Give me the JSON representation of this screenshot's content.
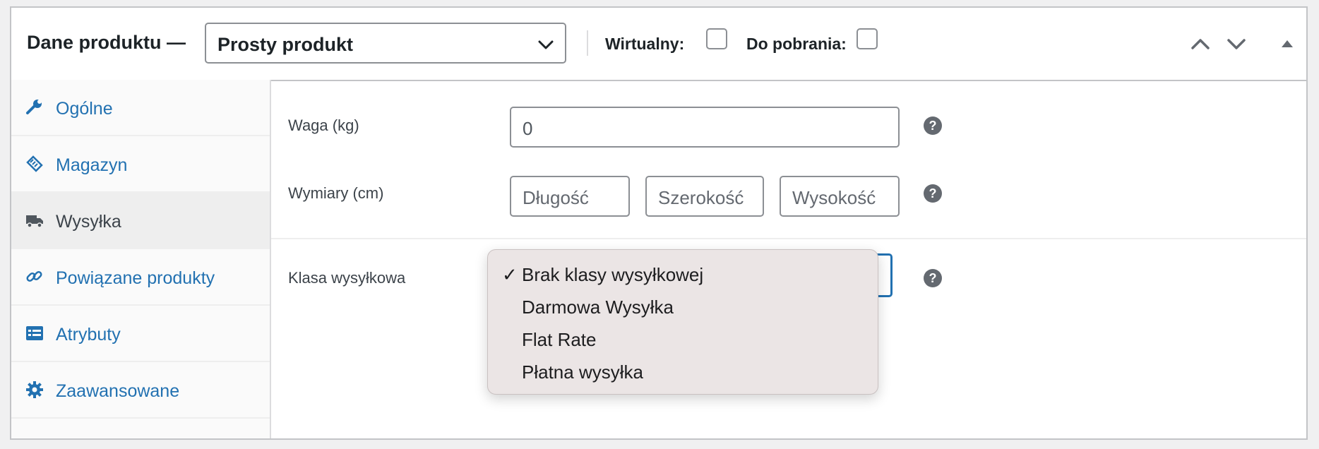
{
  "header": {
    "title": "Dane produktu —",
    "product_type": {
      "selected": "Prosty produkt"
    },
    "virtual_label": "Wirtualny:",
    "virtual_checked": false,
    "downloadable_label": "Do pobrania:",
    "downloadable_checked": false,
    "icons": [
      "chevron-up-icon",
      "chevron-down-icon",
      "triangle-up-icon"
    ]
  },
  "sidebar": {
    "items": [
      {
        "label": "Ogólne",
        "icon": "wrench-icon",
        "active": false
      },
      {
        "label": "Magazyn",
        "icon": "tag-icon",
        "active": false
      },
      {
        "label": "Wysyłka",
        "icon": "truck-icon",
        "active": true
      },
      {
        "label": "Powiązane produkty",
        "icon": "link-icon",
        "active": false
      },
      {
        "label": "Atrybuty",
        "icon": "list-icon",
        "active": false
      },
      {
        "label": "Zaawansowane",
        "icon": "gear-icon",
        "active": false
      }
    ]
  },
  "shipping": {
    "weight": {
      "label": "Waga (kg)",
      "value": "0"
    },
    "dimensions": {
      "label": "Wymiary (cm)",
      "length_placeholder": "Długość",
      "width_placeholder": "Szerokość",
      "height_placeholder": "Wysokość"
    },
    "shipping_class": {
      "label": "Klasa wysyłkowa",
      "options": [
        "Brak klasy wysyłkowej",
        "Darmowa Wysyłka",
        "Flat Rate",
        "Płatna wysyłka"
      ],
      "selected_index": 0
    },
    "help_glyph": "?"
  },
  "colors": {
    "link": "#2271b1",
    "border": "#c3c4c7",
    "focus": "#2271b1",
    "dropdown_bg": "#ebe5e5"
  }
}
